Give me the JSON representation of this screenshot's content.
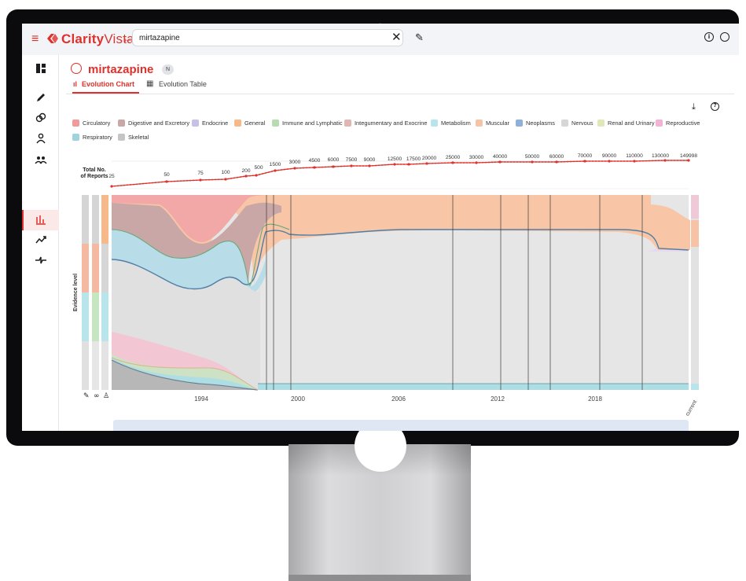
{
  "app": {
    "brand": "ClarityVista",
    "brand_primary": "Clarity",
    "brand_secondary": "Vista",
    "accent": "#e0302a"
  },
  "search": {
    "value": "mirtazapine"
  },
  "page": {
    "title": "mirtazapine",
    "badge": "N"
  },
  "tabs": [
    {
      "label": "Evolution Chart",
      "active": true
    },
    {
      "label": "Evolution Table",
      "active": false
    }
  ],
  "sidebar": {
    "icons": [
      "dashboard-icon",
      "pen-icon",
      "link-icon",
      "person-icon",
      "group-icon",
      "evolution-chart-icon",
      "trend-icon",
      "compare-icon"
    ],
    "active": "evolution-chart-icon"
  },
  "legend": [
    {
      "label": "Circulatory",
      "color": "#f29a9a"
    },
    {
      "label": "Digestive and Excretory",
      "color": "#c9a7a7"
    },
    {
      "label": "Endocrine",
      "color": "#c9c0e8"
    },
    {
      "label": "General",
      "color": "#f7b98a"
    },
    {
      "label": "Immune and Lymphatic",
      "color": "#b8dcb0"
    },
    {
      "label": "Integumentary and Exocrine",
      "color": "#e0b7b3"
    },
    {
      "label": "Metabolism",
      "color": "#b8e4ec"
    },
    {
      "label": "Muscular",
      "color": "#f7c3a7"
    },
    {
      "label": "Neoplasms",
      "color": "#8fb0d8"
    },
    {
      "label": "Nervous",
      "color": "#d6d6d6"
    },
    {
      "label": "Renal and Urinary",
      "color": "#dfe9b8"
    },
    {
      "label": "Reproductive",
      "color": "#f3b3d6"
    },
    {
      "label": "Respiratory",
      "color": "#9fd3dd"
    },
    {
      "label": "Skeletal",
      "color": "#c5c5c5"
    }
  ],
  "chart_data": {
    "type": "area",
    "ylabel": "Evidence level",
    "reports_label": "Total No. of Reports",
    "x_ticks": [
      "1994",
      "2000",
      "2006",
      "2012",
      "2018",
      "current"
    ],
    "report_milestones": [
      "25",
      "50",
      "75",
      "100",
      "200",
      "500",
      "1500",
      "3000",
      "4500",
      "6000",
      "7500",
      "9000",
      "12500",
      "17500",
      "20000",
      "25000",
      "30000",
      "40000",
      "50000",
      "60000",
      "70000",
      "90000",
      "110000",
      "130000",
      "149998"
    ],
    "side_strip_icons": [
      "pen-icon",
      "link-icon",
      "person-icon"
    ],
    "colors": {
      "line": "#e0302a",
      "background": "#e6e6e6"
    }
  }
}
